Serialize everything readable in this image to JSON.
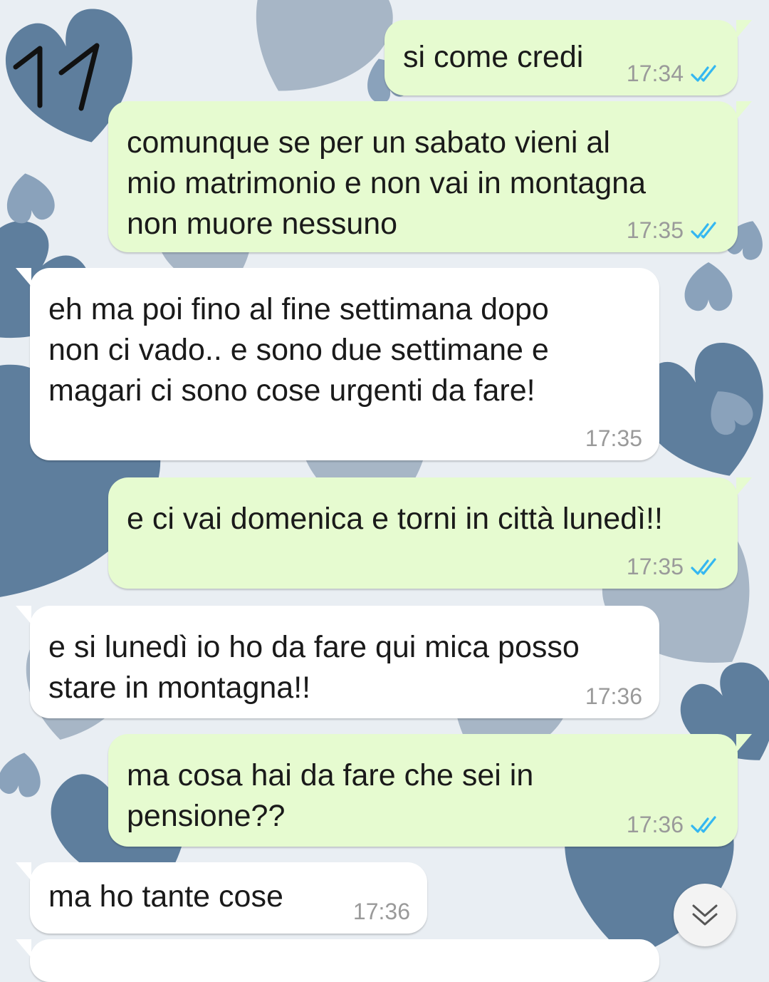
{
  "annotation": {
    "text": "11"
  },
  "colors": {
    "outgoing_bubble": "#e6fbd0",
    "incoming_bubble": "#ffffff",
    "read_ticks": "#34b7f1",
    "wallpaper_blue": "#5f7f9f"
  },
  "messages": [
    {
      "direction": "outgoing",
      "text": "si come credi",
      "time": "17:34",
      "status": "read"
    },
    {
      "direction": "outgoing",
      "text": "comunque se per un sabato vieni al\nmio matrimonio e non vai in montagna\nnon muore nessuno",
      "time": "17:35",
      "status": "read"
    },
    {
      "direction": "incoming",
      "text": "eh ma poi fino al fine settimana dopo\nnon ci vado.. e sono due settimane e\nmagari ci sono cose urgenti da fare!",
      "time": "17:35"
    },
    {
      "direction": "outgoing",
      "text": "e ci vai domenica e torni in città lunedì!!",
      "time": "17:35",
      "status": "read"
    },
    {
      "direction": "incoming",
      "text": "e si lunedì io ho da fare qui mica posso\nstare in montagna!!",
      "time": "17:36"
    },
    {
      "direction": "outgoing",
      "text": "ma cosa hai da fare che sei in\npensione??",
      "time": "17:36",
      "status": "read"
    },
    {
      "direction": "incoming",
      "text": "ma ho tante cose",
      "time": "17:36"
    }
  ],
  "scroll_button": {
    "icon": "double-chevron-down-icon"
  }
}
